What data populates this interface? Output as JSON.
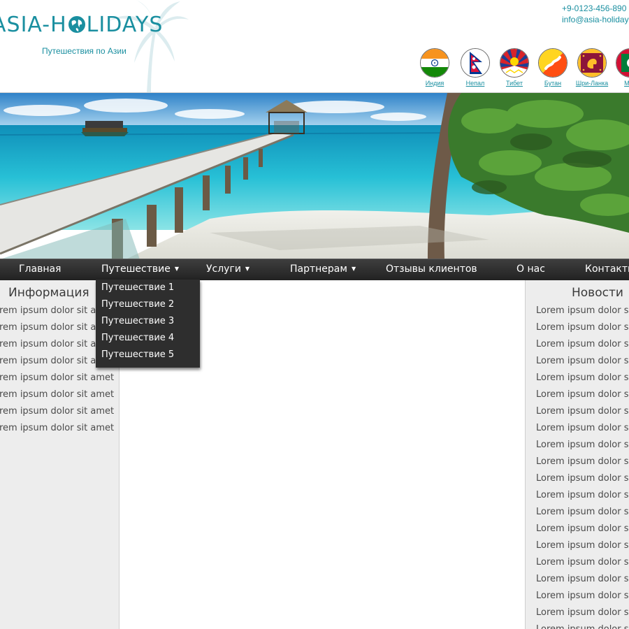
{
  "header": {
    "logo_text_before": "ASIA-H",
    "logo_text_after": "LIDAYS",
    "tagline": "Путешествия по Азии",
    "phone": "+9-0123-456-890",
    "email": "info@asia-holidays"
  },
  "flags": [
    {
      "label": "Индия",
      "icon": "india-flag-icon"
    },
    {
      "label": "Непал",
      "icon": "nepal-flag-icon"
    },
    {
      "label": "Тибет",
      "icon": "tibet-flag-icon"
    },
    {
      "label": "Бутан",
      "icon": "bhutan-flag-icon"
    },
    {
      "label": "Шри-Ланка",
      "icon": "sri-lanka-flag-icon"
    },
    {
      "label": "Мал",
      "icon": "maldives-flag-icon"
    }
  ],
  "nav": {
    "items": [
      {
        "label": "Главная",
        "has_submenu": false
      },
      {
        "label": "Путешествие",
        "has_submenu": true
      },
      {
        "label": "Услуги",
        "has_submenu": true
      },
      {
        "label": "Партнерам",
        "has_submenu": true
      },
      {
        "label": "Отзывы клиентов",
        "has_submenu": false
      },
      {
        "label": "О нас",
        "has_submenu": false
      },
      {
        "label": "Контакты",
        "has_submenu": false
      }
    ],
    "caret": "▼"
  },
  "dropdown": {
    "items": [
      "Путешествие 1",
      "Путешествие 2",
      "Путешествие 3",
      "Путешествие 4",
      "Путешествие 5"
    ]
  },
  "left_sidebar": {
    "title": "Информация",
    "items": [
      "Lorem ipsum dolor sit amet",
      "Lorem ipsum dolor sit amet",
      "Lorem ipsum dolor sit amet",
      "Lorem ipsum dolor sit amet",
      "Lorem ipsum dolor sit amet",
      "Lorem ipsum dolor sit amet",
      "Lorem ipsum dolor sit amet",
      "Lorem ipsum dolor sit amet"
    ]
  },
  "right_sidebar": {
    "title": "Новости",
    "items": [
      "Lorem ipsum dolor sit",
      "Lorem ipsum dolor sit",
      "Lorem ipsum dolor sit",
      "Lorem ipsum dolor sit",
      "Lorem ipsum dolor sit",
      "Lorem ipsum dolor sit",
      "Lorem ipsum dolor sit",
      "Lorem ipsum dolor sit",
      "Lorem ipsum dolor sit",
      "Lorem ipsum dolor sit",
      "Lorem ipsum dolor sit",
      "Lorem ipsum dolor sit",
      "Lorem ipsum dolor sit",
      "Lorem ipsum dolor sit",
      "Lorem ipsum dolor sit",
      "Lorem ipsum dolor sit",
      "Lorem ipsum dolor sit",
      "Lorem ipsum dolor sit",
      "Lorem ipsum dolor sit",
      "Lorem ipsum dolor sit"
    ]
  },
  "colors": {
    "brand": "#1a8fa0",
    "nav_bg": "#2b2b2b",
    "sidebar_bg": "#ededed"
  }
}
